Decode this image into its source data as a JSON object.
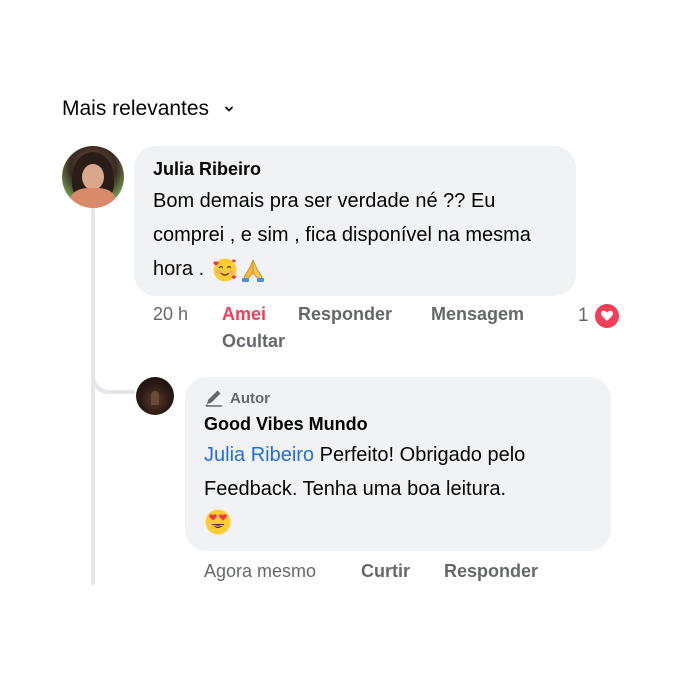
{
  "sort": {
    "label": "Mais relevantes"
  },
  "comment": {
    "author": "Julia Ribeiro",
    "text": "Bom demais pra ser verdade né ?? Eu comprei , e sim , fica disponível na mesma hora . ",
    "emojis": [
      "smiling-face-with-hearts",
      "folded-hands"
    ],
    "time": "20 h",
    "reaction_label": "Amei",
    "reply_label": "Responder",
    "message_label": "Mensagem",
    "hide_label": "Ocultar",
    "reaction_count": "1",
    "colors": {
      "reaction": "#f33e58",
      "secondary": "#65676b",
      "bubble": "#f0f2f5"
    }
  },
  "reply": {
    "badge": "Autor",
    "author": "Good Vibes Mundo",
    "mention": "Julia Ribeiro",
    "text": " Perfeito! Obrigado pelo Feedback. Tenha uma boa leitura.",
    "emoji": "heart-eyes-face",
    "time": "Agora mesmo",
    "like_label": "Curtir",
    "reply_label": "Responder",
    "colors": {
      "mention": "#216fdb"
    }
  }
}
